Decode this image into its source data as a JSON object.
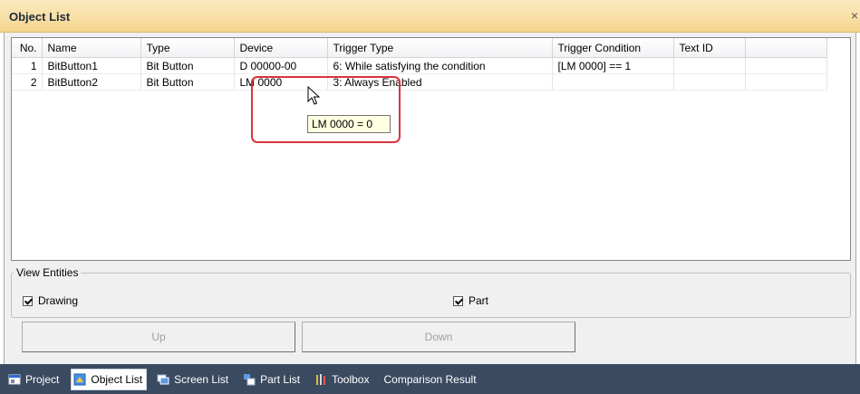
{
  "window": {
    "title": "Object List",
    "close_glyph": "×"
  },
  "table": {
    "columns": [
      "No.",
      "Name",
      "Type",
      "Device",
      "Trigger Type",
      "Trigger Condition",
      "Text ID"
    ],
    "rows": [
      {
        "no": "1",
        "name": "BitButton1",
        "type": "Bit Button",
        "device": "D 00000-00",
        "trigger_type": "6: While satisfying the condition",
        "trigger_condition": "[LM 0000] == 1",
        "text_id": ""
      },
      {
        "no": "2",
        "name": "BitButton2",
        "type": "Bit Button",
        "device": "LM 0000",
        "trigger_type": "3: Always Enabled",
        "trigger_condition": "",
        "text_id": ""
      }
    ]
  },
  "tooltip": {
    "text": "LM 0000 = 0"
  },
  "view_entities": {
    "label": "View Entities",
    "drawing_label": "Drawing",
    "drawing_checked": true,
    "part_label": "Part",
    "part_checked": true
  },
  "buttons": {
    "up_label": "Up",
    "down_label": "Down"
  },
  "tabs": [
    {
      "label": "Project",
      "icon": "project-icon"
    },
    {
      "label": "Object List",
      "icon": "object-list-icon",
      "active": true
    },
    {
      "label": "Screen List",
      "icon": "screen-list-icon"
    },
    {
      "label": "Part List",
      "icon": "part-list-icon"
    },
    {
      "label": "Toolbox",
      "icon": "toolbox-icon"
    },
    {
      "label": "Comparison Result",
      "icon": ""
    }
  ],
  "colors": {
    "highlight": "#d9343c",
    "tabbar": "#3a4a60",
    "title_bg": "#f5d58f",
    "tooltip_bg": "#ffffe1"
  }
}
